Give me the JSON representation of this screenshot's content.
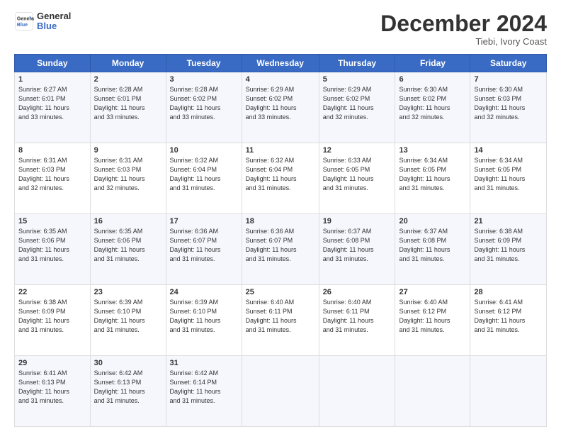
{
  "logo": {
    "line1": "General",
    "line2": "Blue"
  },
  "title": "December 2024",
  "location": "Tiebi, Ivory Coast",
  "days_header": [
    "Sunday",
    "Monday",
    "Tuesday",
    "Wednesday",
    "Thursday",
    "Friday",
    "Saturday"
  ],
  "weeks": [
    [
      {
        "day": "1",
        "info": "Sunrise: 6:27 AM\nSunset: 6:01 PM\nDaylight: 11 hours\nand 33 minutes."
      },
      {
        "day": "2",
        "info": "Sunrise: 6:28 AM\nSunset: 6:01 PM\nDaylight: 11 hours\nand 33 minutes."
      },
      {
        "day": "3",
        "info": "Sunrise: 6:28 AM\nSunset: 6:02 PM\nDaylight: 11 hours\nand 33 minutes."
      },
      {
        "day": "4",
        "info": "Sunrise: 6:29 AM\nSunset: 6:02 PM\nDaylight: 11 hours\nand 33 minutes."
      },
      {
        "day": "5",
        "info": "Sunrise: 6:29 AM\nSunset: 6:02 PM\nDaylight: 11 hours\nand 32 minutes."
      },
      {
        "day": "6",
        "info": "Sunrise: 6:30 AM\nSunset: 6:02 PM\nDaylight: 11 hours\nand 32 minutes."
      },
      {
        "day": "7",
        "info": "Sunrise: 6:30 AM\nSunset: 6:03 PM\nDaylight: 11 hours\nand 32 minutes."
      }
    ],
    [
      {
        "day": "8",
        "info": "Sunrise: 6:31 AM\nSunset: 6:03 PM\nDaylight: 11 hours\nand 32 minutes."
      },
      {
        "day": "9",
        "info": "Sunrise: 6:31 AM\nSunset: 6:03 PM\nDaylight: 11 hours\nand 32 minutes."
      },
      {
        "day": "10",
        "info": "Sunrise: 6:32 AM\nSunset: 6:04 PM\nDaylight: 11 hours\nand 31 minutes."
      },
      {
        "day": "11",
        "info": "Sunrise: 6:32 AM\nSunset: 6:04 PM\nDaylight: 11 hours\nand 31 minutes."
      },
      {
        "day": "12",
        "info": "Sunrise: 6:33 AM\nSunset: 6:05 PM\nDaylight: 11 hours\nand 31 minutes."
      },
      {
        "day": "13",
        "info": "Sunrise: 6:34 AM\nSunset: 6:05 PM\nDaylight: 11 hours\nand 31 minutes."
      },
      {
        "day": "14",
        "info": "Sunrise: 6:34 AM\nSunset: 6:05 PM\nDaylight: 11 hours\nand 31 minutes."
      }
    ],
    [
      {
        "day": "15",
        "info": "Sunrise: 6:35 AM\nSunset: 6:06 PM\nDaylight: 11 hours\nand 31 minutes."
      },
      {
        "day": "16",
        "info": "Sunrise: 6:35 AM\nSunset: 6:06 PM\nDaylight: 11 hours\nand 31 minutes."
      },
      {
        "day": "17",
        "info": "Sunrise: 6:36 AM\nSunset: 6:07 PM\nDaylight: 11 hours\nand 31 minutes."
      },
      {
        "day": "18",
        "info": "Sunrise: 6:36 AM\nSunset: 6:07 PM\nDaylight: 11 hours\nand 31 minutes."
      },
      {
        "day": "19",
        "info": "Sunrise: 6:37 AM\nSunset: 6:08 PM\nDaylight: 11 hours\nand 31 minutes."
      },
      {
        "day": "20",
        "info": "Sunrise: 6:37 AM\nSunset: 6:08 PM\nDaylight: 11 hours\nand 31 minutes."
      },
      {
        "day": "21",
        "info": "Sunrise: 6:38 AM\nSunset: 6:09 PM\nDaylight: 11 hours\nand 31 minutes."
      }
    ],
    [
      {
        "day": "22",
        "info": "Sunrise: 6:38 AM\nSunset: 6:09 PM\nDaylight: 11 hours\nand 31 minutes."
      },
      {
        "day": "23",
        "info": "Sunrise: 6:39 AM\nSunset: 6:10 PM\nDaylight: 11 hours\nand 31 minutes."
      },
      {
        "day": "24",
        "info": "Sunrise: 6:39 AM\nSunset: 6:10 PM\nDaylight: 11 hours\nand 31 minutes."
      },
      {
        "day": "25",
        "info": "Sunrise: 6:40 AM\nSunset: 6:11 PM\nDaylight: 11 hours\nand 31 minutes."
      },
      {
        "day": "26",
        "info": "Sunrise: 6:40 AM\nSunset: 6:11 PM\nDaylight: 11 hours\nand 31 minutes."
      },
      {
        "day": "27",
        "info": "Sunrise: 6:40 AM\nSunset: 6:12 PM\nDaylight: 11 hours\nand 31 minutes."
      },
      {
        "day": "28",
        "info": "Sunrise: 6:41 AM\nSunset: 6:12 PM\nDaylight: 11 hours\nand 31 minutes."
      }
    ],
    [
      {
        "day": "29",
        "info": "Sunrise: 6:41 AM\nSunset: 6:13 PM\nDaylight: 11 hours\nand 31 minutes."
      },
      {
        "day": "30",
        "info": "Sunrise: 6:42 AM\nSunset: 6:13 PM\nDaylight: 11 hours\nand 31 minutes."
      },
      {
        "day": "31",
        "info": "Sunrise: 6:42 AM\nSunset: 6:14 PM\nDaylight: 11 hours\nand 31 minutes."
      },
      null,
      null,
      null,
      null
    ]
  ]
}
